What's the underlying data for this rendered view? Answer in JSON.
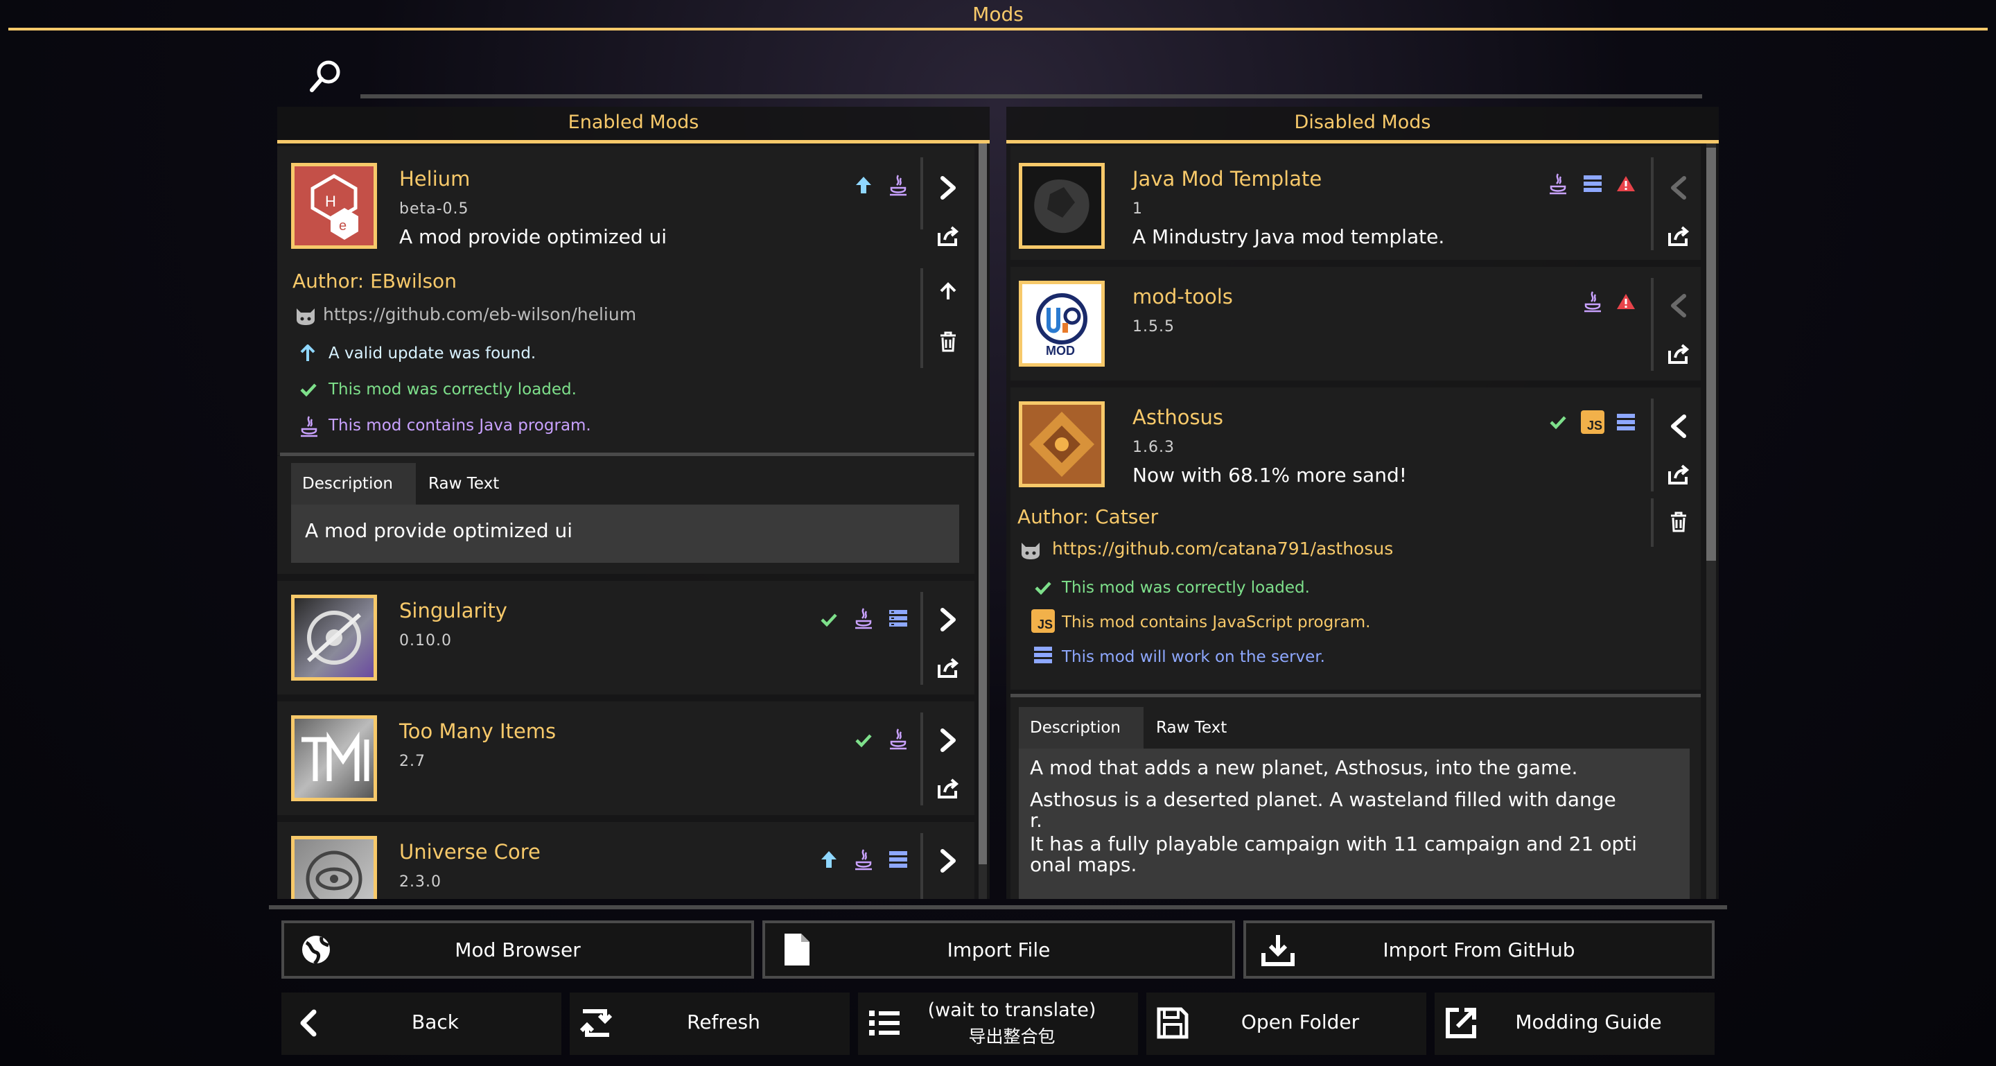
{
  "window": {
    "title": "Mods"
  },
  "search": {
    "placeholder": ""
  },
  "panels": {
    "enabled_title": "Enabled Mods",
    "disabled_title": "Disabled Mods"
  },
  "enabled_mods": [
    {
      "name": "Helium",
      "version": "beta-0.5",
      "desc": "A mod provide optimized ui",
      "author": "Author: EBwilson",
      "url": "https://github.com/eb-wilson/helium",
      "info": [
        "A valid update was found.",
        "This mod was correctly loaded.",
        "This mod contains Java program."
      ],
      "tabs": [
        "Description",
        "Raw Text"
      ],
      "description": "A mod provide optimized ui"
    },
    {
      "name": "Singularity",
      "version": "0.10.0"
    },
    {
      "name": "Too Many Items",
      "version": "2.7"
    },
    {
      "name": "Universe Core",
      "version": "2.3.0"
    }
  ],
  "disabled_mods": [
    {
      "name": "Java Mod Template",
      "version": "1",
      "desc": "A Mindustry Java mod template."
    },
    {
      "name": "mod-tools",
      "version": "1.5.5"
    },
    {
      "name": "Asthosus",
      "version": "1.6.3",
      "desc": "Now with 68.1% more sand!",
      "author": "Author: Catser",
      "url": "https://github.com/catana791/asthosus",
      "info": [
        "This mod was correctly loaded.",
        "This mod contains JavaScript program.",
        "This mod will work on the server."
      ],
      "tabs": [
        "Description",
        "Raw Text"
      ],
      "description": [
        "A mod that adds a new planet, Asthosus, into the game.",
        "Asthosus is a deserted planet. A wasteland filled with dange",
        "r.",
        "It has a fully playable campaign with 11 campaign and 21 opti",
        "onal maps."
      ]
    }
  ],
  "icons": {
    "js_badge": "JS",
    "mod_logo_text": "MOD"
  },
  "buttons": {
    "mod_browser": "Mod Browser",
    "import_file": "Import File",
    "import_github": "Import From GitHub",
    "back": "Back",
    "refresh": "Refresh",
    "export_line1": "(wait to translate)",
    "export_line2": "导出整合包",
    "open_folder": "Open Folder",
    "modding_guide": "Modding Guide"
  },
  "colors": {
    "accent": "#f7c96a",
    "update": "#8fd7ff",
    "loaded": "#7ee08b",
    "java": "#c9a2ff",
    "server": "#8ea8ff",
    "warning": "#e8434a"
  }
}
